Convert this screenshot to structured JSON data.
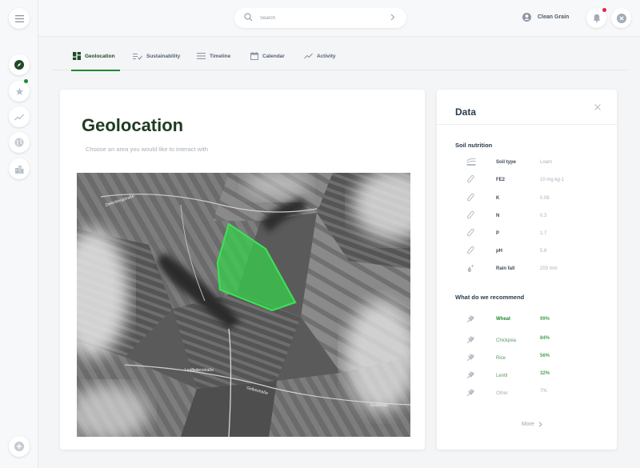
{
  "header": {
    "search_placeholder": "Search",
    "user_name": "Clean Grain"
  },
  "tabs": [
    {
      "label": "Geolocation",
      "icon": "dashboard-icon",
      "active": true
    },
    {
      "label": "Sustainability",
      "icon": "checklist-icon",
      "active": false
    },
    {
      "label": "Timeline",
      "icon": "list-lines-icon",
      "active": false
    },
    {
      "label": "Calendar",
      "icon": "calendar-icon",
      "active": false
    },
    {
      "label": "Activity",
      "icon": "trend-icon",
      "active": false
    }
  ],
  "geolocation": {
    "title": "Geolocation",
    "subtitle": "Choose an area you would like to interact with"
  },
  "data_panel": {
    "title": "Data",
    "soil_section_title": "Soil nutrition",
    "soil": [
      {
        "label": "Soil type",
        "value": "Loam",
        "icon": "soil-layers-icon"
      },
      {
        "label": "FE2",
        "value": "10 mg kg-1",
        "icon": "test-tube-icon"
      },
      {
        "label": "K",
        "value": "0.08",
        "icon": "test-tube-icon"
      },
      {
        "label": "N",
        "value": "0.3",
        "icon": "test-tube-icon"
      },
      {
        "label": "P",
        "value": "1.7",
        "icon": "test-tube-icon"
      },
      {
        "label": "pH",
        "value": "5.6",
        "icon": "test-tube-icon"
      },
      {
        "label": "Rain fall",
        "value": "203 mm",
        "icon": "raindrop-icon"
      }
    ],
    "recommend_section_title": "What do we recommend",
    "recommendations": [
      {
        "label": "Wheat",
        "value": "99%"
      },
      {
        "label": "Chickpea",
        "value": "84%"
      },
      {
        "label": "Rice",
        "value": "56%"
      },
      {
        "label": "Lentil",
        "value": "32%"
      },
      {
        "label": "Other",
        "value": "7%"
      }
    ],
    "more_label": "More"
  },
  "map": {
    "street_labels": [
      "Zeilenbergstraße",
      "Leafiedenstraße",
      "Gelbestraße",
      "Gedersau"
    ]
  },
  "colors": {
    "accent": "#1e8a2e",
    "selection": "#35d24a",
    "notification": "#e3224a"
  }
}
